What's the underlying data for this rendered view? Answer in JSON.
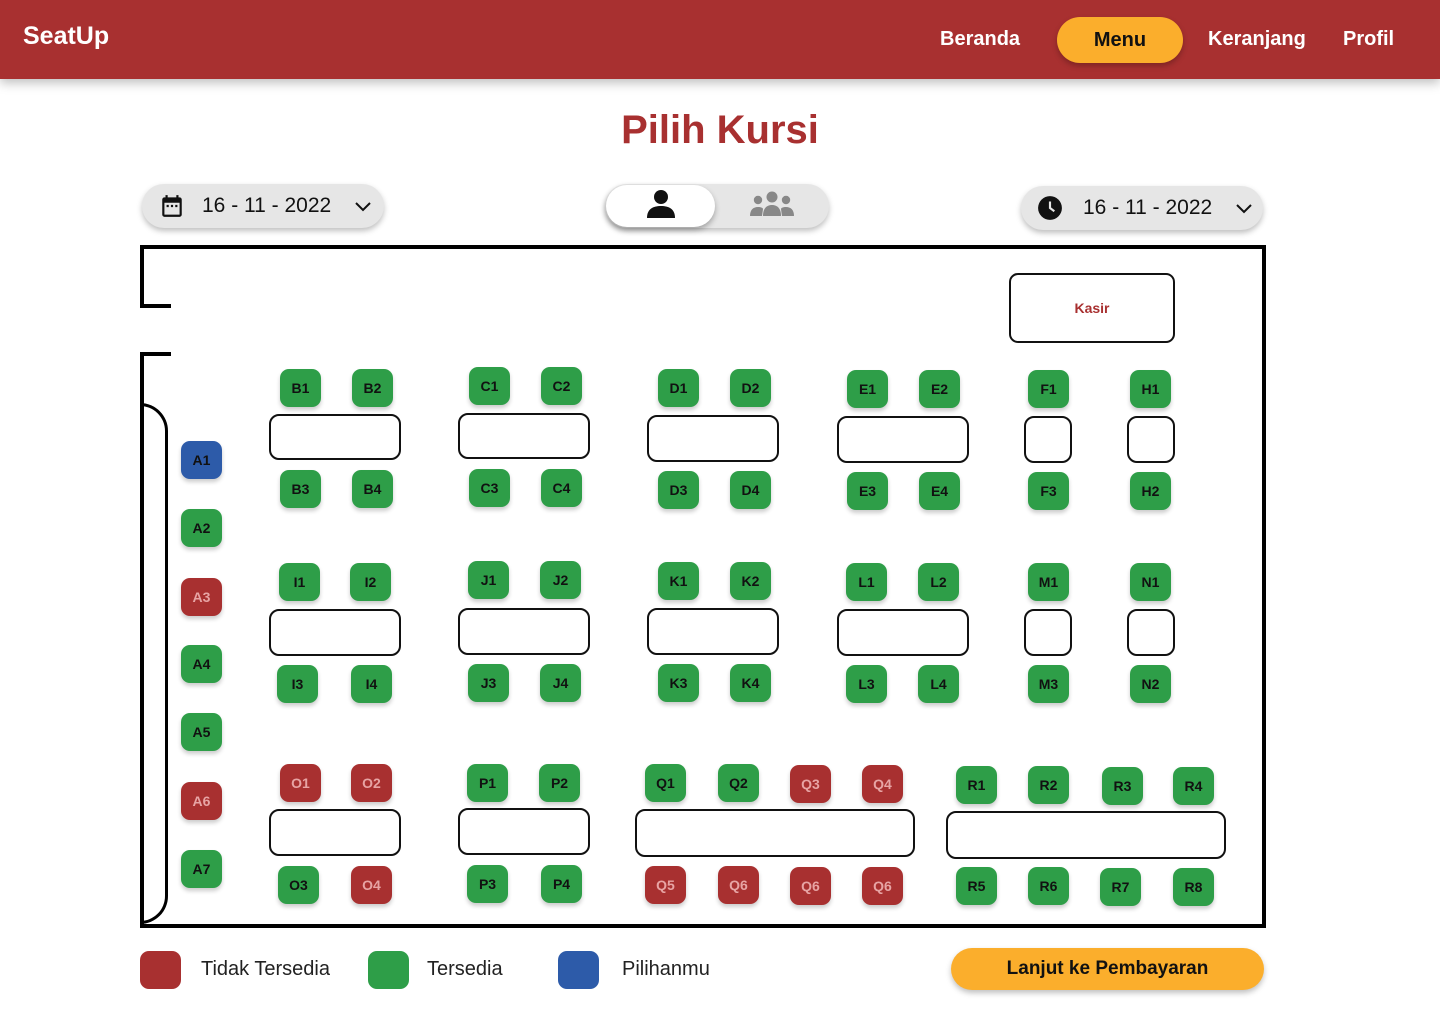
{
  "app": {
    "name": "SeatUp"
  },
  "nav": {
    "home": "Beranda",
    "menu": "Menu",
    "cart": "Keranjang",
    "profile": "Profil"
  },
  "page": {
    "title": "Pilih Kursi"
  },
  "controls": {
    "date_value": "16 - 11 - 2022",
    "time_value": "16 - 11 - 2022",
    "date_icon": "calendar-icon",
    "time_icon": "clock-icon",
    "mode_options": [
      {
        "icon": "single-person-icon",
        "active": true
      },
      {
        "icon": "group-icon",
        "active": false
      }
    ]
  },
  "floor": {
    "cashier_label": "Kasir"
  },
  "seats": [
    {
      "id": "A1",
      "status": "selected"
    },
    {
      "id": "A2",
      "status": "available"
    },
    {
      "id": "A3",
      "status": "unavailable"
    },
    {
      "id": "A4",
      "status": "available"
    },
    {
      "id": "A5",
      "status": "available"
    },
    {
      "id": "A6",
      "status": "unavailable"
    },
    {
      "id": "A7",
      "status": "available"
    },
    {
      "id": "B1",
      "status": "available"
    },
    {
      "id": "B2",
      "status": "available"
    },
    {
      "id": "B3",
      "status": "available"
    },
    {
      "id": "B4",
      "status": "available"
    },
    {
      "id": "C1",
      "status": "available"
    },
    {
      "id": "C2",
      "status": "available"
    },
    {
      "id": "C3",
      "status": "available"
    },
    {
      "id": "C4",
      "status": "available"
    },
    {
      "id": "D1",
      "status": "available"
    },
    {
      "id": "D2",
      "status": "available"
    },
    {
      "id": "D3",
      "status": "available"
    },
    {
      "id": "D4",
      "status": "available"
    },
    {
      "id": "E1",
      "status": "available"
    },
    {
      "id": "E2",
      "status": "available"
    },
    {
      "id": "E3",
      "status": "available"
    },
    {
      "id": "E4",
      "status": "available"
    },
    {
      "id": "F1",
      "status": "available"
    },
    {
      "id": "F3",
      "status": "available"
    },
    {
      "id": "H1",
      "status": "available"
    },
    {
      "id": "H2",
      "status": "available"
    },
    {
      "id": "I1",
      "status": "available"
    },
    {
      "id": "I2",
      "status": "available"
    },
    {
      "id": "I3",
      "status": "available"
    },
    {
      "id": "I4",
      "status": "available"
    },
    {
      "id": "J1",
      "status": "available"
    },
    {
      "id": "J2",
      "status": "available"
    },
    {
      "id": "J3",
      "status": "available"
    },
    {
      "id": "J4",
      "status": "available"
    },
    {
      "id": "K1",
      "status": "available"
    },
    {
      "id": "K2",
      "status": "available"
    },
    {
      "id": "K3",
      "status": "available"
    },
    {
      "id": "K4",
      "status": "available"
    },
    {
      "id": "L1",
      "status": "available"
    },
    {
      "id": "L2",
      "status": "available"
    },
    {
      "id": "L3",
      "status": "available"
    },
    {
      "id": "L4",
      "status": "available"
    },
    {
      "id": "M1",
      "status": "available"
    },
    {
      "id": "M3",
      "status": "available"
    },
    {
      "id": "N1",
      "status": "available"
    },
    {
      "id": "N2",
      "status": "available"
    },
    {
      "id": "O1",
      "status": "unavailable"
    },
    {
      "id": "O2",
      "status": "unavailable"
    },
    {
      "id": "O3",
      "status": "available"
    },
    {
      "id": "O4",
      "status": "unavailable"
    },
    {
      "id": "P1",
      "status": "available"
    },
    {
      "id": "P2",
      "status": "available"
    },
    {
      "id": "P3",
      "status": "available"
    },
    {
      "id": "P4",
      "status": "available"
    },
    {
      "id": "Q1",
      "status": "available"
    },
    {
      "id": "Q2",
      "status": "available"
    },
    {
      "id": "Q3",
      "status": "unavailable"
    },
    {
      "id": "Q4",
      "status": "unavailable"
    },
    {
      "id": "Q5",
      "status": "unavailable"
    },
    {
      "id": "Q6",
      "status": "unavailable"
    },
    {
      "id": "Q6",
      "status": "unavailable"
    },
    {
      "id": "Q6",
      "status": "unavailable"
    },
    {
      "id": "R1",
      "status": "available"
    },
    {
      "id": "R2",
      "status": "available"
    },
    {
      "id": "R3",
      "status": "available"
    },
    {
      "id": "R4",
      "status": "available"
    },
    {
      "id": "R5",
      "status": "available"
    },
    {
      "id": "R6",
      "status": "available"
    },
    {
      "id": "R7",
      "status": "available"
    },
    {
      "id": "R8",
      "status": "available"
    }
  ],
  "legend": {
    "unavailable": "Tidak Tersedia",
    "available": "Tersedia",
    "selected": "Pilihanmu"
  },
  "colors": {
    "brand": "#a83030",
    "accent": "#fbae2c",
    "available": "#2e9e48",
    "unavailable": "#a83030",
    "selected": "#2d5ba9"
  },
  "actions": {
    "checkout": "Lanjut ke Pembayaran"
  }
}
